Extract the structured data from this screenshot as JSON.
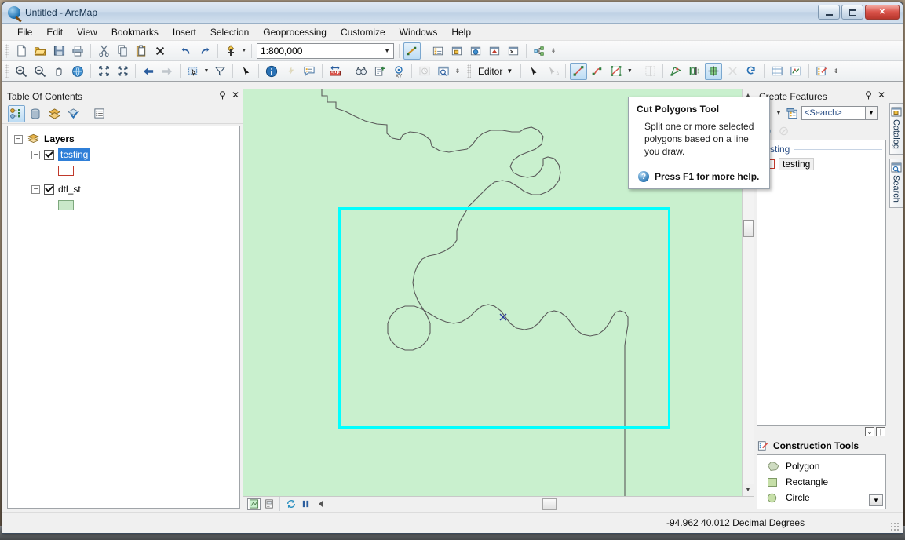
{
  "window": {
    "title": "Untitled - ArcMap",
    "app_icon": "arcmap-globe-icon",
    "buttons": {
      "minimize": "minimize-button",
      "maximize": "maximize-button",
      "close": "close-button"
    }
  },
  "menubar": {
    "items": [
      "File",
      "Edit",
      "View",
      "Bookmarks",
      "Insert",
      "Selection",
      "Geoprocessing",
      "Customize",
      "Windows",
      "Help"
    ]
  },
  "standard_toolbar": {
    "scale": {
      "value": "1:800,000"
    },
    "buttons": [
      "new-document-icon",
      "open-icon",
      "save-icon",
      "print-icon",
      "cut-icon",
      "copy-icon",
      "paste-icon",
      "delete-icon",
      "undo-icon",
      "redo-icon",
      "add-data-icon",
      "editor-toolbar-icon",
      "table-of-contents-icon",
      "catalog-icon",
      "arctoolbox-icon",
      "model-builder-icon",
      "python-window-icon",
      "geoprocessing-results-icon"
    ]
  },
  "tools_toolbar": {
    "buttons": [
      "zoom-in-icon",
      "zoom-out-icon",
      "pan-icon",
      "full-extent-icon",
      "fixed-zoom-in-icon",
      "fixed-zoom-out-icon",
      "go-back-extent-icon",
      "go-next-extent-icon",
      "select-features-icon",
      "select-by-rectangle-dropdown-icon",
      "clear-selection-icon",
      "select-elements-icon",
      "identify-icon",
      "hyperlink-icon",
      "html-popup-icon",
      "measure-icon",
      "find-icon",
      "find-route-icon",
      "go-to-xy-icon",
      "time-slider-icon",
      "create-viewer-window-icon"
    ]
  },
  "editor_toolbar": {
    "editor_label": "Editor",
    "buttons": [
      "edit-tool-icon",
      "edit-annotation-tool-icon",
      "straight-segment-icon",
      "trace-icon",
      "cut-polygons-tool-icon",
      "split-tool-icon",
      "reshape-feature-icon",
      "mirror-features-icon",
      "cut-polygons-active-icon",
      "construction-cross-icon",
      "rotate-icon",
      "attributes-icon",
      "sketch-properties-icon",
      "create-features-window-icon"
    ],
    "active_tool": "cut-polygons-tool"
  },
  "tooltip": {
    "title": "Cut Polygons Tool",
    "body": "Split one or more selected polygons based on a line you draw.",
    "help_text": "Press F1 for more help.",
    "help_icon": "help-circle-icon"
  },
  "toc": {
    "header": {
      "title": "Table Of Contents",
      "pin": "pin-icon",
      "close": "close-icon"
    },
    "toolbar_buttons": [
      "list-by-drawing-order-icon",
      "list-by-source-icon",
      "list-by-visibility-icon",
      "list-by-selection-icon",
      "options-icon"
    ],
    "root": {
      "label": "Layers",
      "icon": "data-frame-icon"
    },
    "layers": [
      {
        "name": "testing",
        "checked": true,
        "selected": true,
        "symbol_color": "#c0392b",
        "symbol_fill": "#ffffff"
      },
      {
        "name": "dtl_st",
        "checked": true,
        "selected": false,
        "symbol_color": "#7da87d",
        "symbol_fill": "#c9e8c9"
      }
    ]
  },
  "map": {
    "background_color": "#c9f0ce",
    "selection_color": "#00ffff",
    "river_color": "#555555",
    "sketch_marker": "sketch-vertex-x-marker",
    "statusbar_buttons": [
      "data-view-icon",
      "layout-view-icon",
      "refresh-icon",
      "pause-drawing-icon",
      "scroll-left-icon"
    ]
  },
  "create_features": {
    "header": {
      "title": "Create Features",
      "pin": "pin-icon",
      "close": "close-icon"
    },
    "toolbar_buttons": [
      "organize-templates-icon",
      "templates-dropdown-icon",
      "create-new-template-icon"
    ],
    "toolbar2_buttons": [
      "help-icon",
      "disabled-tool-icon"
    ],
    "search": {
      "placeholder": "<Search>",
      "value": "<Search>",
      "dropdown": "chevron-down-icon"
    },
    "group_label": "testing",
    "templates": [
      {
        "name": "testing",
        "symbol_color": "#c0392b"
      }
    ],
    "splitter_buttons": [
      "collapse-chevrons-icon",
      "expand-icon"
    ],
    "construction_tools": {
      "title": "Construction Tools",
      "icon": "construction-tools-icon",
      "items": [
        {
          "label": "Polygon",
          "icon": "polygon-tool-icon"
        },
        {
          "label": "Rectangle",
          "icon": "rectangle-tool-icon"
        },
        {
          "label": "Circle",
          "icon": "circle-tool-icon"
        }
      ],
      "scroll_down": "chevron-down-icon"
    }
  },
  "side_tabs": [
    {
      "label": "Catalog",
      "icon": "catalog-icon"
    },
    {
      "label": "Search",
      "icon": "search-icon"
    }
  ],
  "statusbar": {
    "coordinates": "-94.962  40.012 Decimal Degrees"
  }
}
